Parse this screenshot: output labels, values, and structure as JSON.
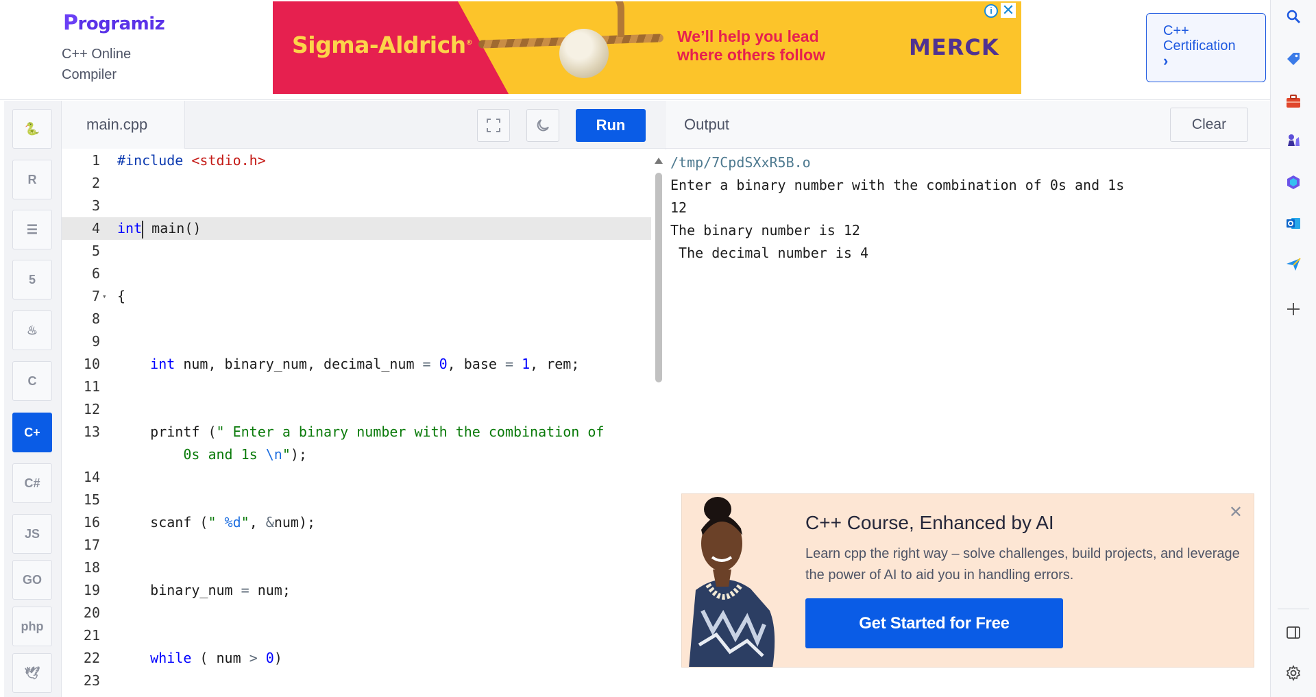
{
  "header": {
    "logo_text": "rogramiz",
    "logo_initial": "P",
    "subtitle": "C++ Online Compiler"
  },
  "ad": {
    "brand": "Sigma-Aldrich",
    "brand_mark": "®",
    "tagline": "We’ll help you lead where others follow",
    "partner": "MERCK",
    "info_glyph": "i",
    "close_glyph": "✕",
    "colors": {
      "red": "#e6204f",
      "yellow": "#fcc42a",
      "purple": "#503291"
    }
  },
  "certification": {
    "label": "C++ Certification",
    "chevron": "›"
  },
  "sidebar": {
    "languages": [
      {
        "name": "python",
        "icon": "python-icon",
        "glyph": "🐍",
        "active": false
      },
      {
        "name": "r",
        "icon": "r-icon",
        "glyph": "R",
        "active": false
      },
      {
        "name": "sql",
        "icon": "database-icon",
        "glyph": "☰",
        "active": false
      },
      {
        "name": "html",
        "icon": "html5-icon",
        "glyph": "5",
        "active": false
      },
      {
        "name": "java",
        "icon": "java-icon",
        "glyph": "♨",
        "active": false
      },
      {
        "name": "c",
        "icon": "c-icon",
        "glyph": "C",
        "active": false
      },
      {
        "name": "cpp",
        "icon": "cpp-icon",
        "glyph": "C+",
        "active": true
      },
      {
        "name": "csharp",
        "icon": "csharp-icon",
        "glyph": "C#",
        "active": false
      },
      {
        "name": "javascript",
        "icon": "js-icon",
        "glyph": "JS",
        "active": false
      },
      {
        "name": "go",
        "icon": "go-icon",
        "glyph": "GO",
        "active": false
      },
      {
        "name": "php",
        "icon": "php-icon",
        "glyph": "php",
        "active": false
      },
      {
        "name": "swift",
        "icon": "swift-icon",
        "glyph": "🕊",
        "active": false
      }
    ]
  },
  "editor": {
    "file_name": "main.cpp",
    "run_label": "Run",
    "active_line": 4,
    "lines": [
      {
        "n": "1",
        "tokens": [
          [
            "pre",
            "#include "
          ],
          [
            "inc",
            "<stdio.h>"
          ]
        ]
      },
      {
        "n": "2",
        "tokens": []
      },
      {
        "n": "3",
        "tokens": []
      },
      {
        "n": "4",
        "tokens": [
          [
            "kw",
            "int"
          ],
          [
            "cursor",
            ""
          ],
          [
            "plain",
            " main()"
          ]
        ]
      },
      {
        "n": "5",
        "tokens": []
      },
      {
        "n": "6",
        "tokens": []
      },
      {
        "n": "7",
        "fold": "▾",
        "tokens": [
          [
            "plain",
            "{"
          ]
        ]
      },
      {
        "n": "8",
        "tokens": []
      },
      {
        "n": "9",
        "tokens": []
      },
      {
        "n": "10",
        "tokens": [
          [
            "plain",
            "    "
          ],
          [
            "kw",
            "int"
          ],
          [
            "plain",
            " num, binary_num, decimal_num "
          ],
          [
            "op",
            "="
          ],
          [
            "plain",
            " "
          ],
          [
            "num",
            "0"
          ],
          [
            "plain",
            ", base "
          ],
          [
            "op",
            "="
          ],
          [
            "plain",
            " "
          ],
          [
            "num",
            "1"
          ],
          [
            "plain",
            ", rem;"
          ]
        ]
      },
      {
        "n": "11",
        "tokens": []
      },
      {
        "n": "12",
        "tokens": []
      },
      {
        "n": "13",
        "tokens": [
          [
            "plain",
            "    printf ("
          ],
          [
            "str",
            "\" Enter a binary number with the combination of"
          ]
        ]
      },
      {
        "n": "",
        "tokens": [
          [
            "str",
            "        0s and 1s "
          ],
          [
            "esc",
            "\\n"
          ],
          [
            "str",
            "\""
          ],
          [
            "plain",
            ");"
          ]
        ]
      },
      {
        "n": "14",
        "tokens": []
      },
      {
        "n": "15",
        "tokens": []
      },
      {
        "n": "16",
        "tokens": [
          [
            "plain",
            "    scanf ("
          ],
          [
            "str",
            "\" "
          ],
          [
            "esc",
            "%d"
          ],
          [
            "str",
            "\""
          ],
          [
            "plain",
            ", "
          ],
          [
            "op",
            "&"
          ],
          [
            "plain",
            "num);"
          ]
        ]
      },
      {
        "n": "17",
        "tokens": []
      },
      {
        "n": "18",
        "tokens": []
      },
      {
        "n": "19",
        "tokens": [
          [
            "plain",
            "    binary_num "
          ],
          [
            "op",
            "="
          ],
          [
            "plain",
            " num;"
          ]
        ]
      },
      {
        "n": "20",
        "tokens": []
      },
      {
        "n": "21",
        "tokens": []
      },
      {
        "n": "22",
        "tokens": [
          [
            "plain",
            "    "
          ],
          [
            "kw",
            "while"
          ],
          [
            "plain",
            " ( num "
          ],
          [
            "op",
            ">"
          ],
          [
            "plain",
            " "
          ],
          [
            "num",
            "0"
          ],
          [
            "plain",
            ")"
          ]
        ]
      },
      {
        "n": "23",
        "tokens": []
      }
    ]
  },
  "output": {
    "title": "Output",
    "clear_label": "Clear",
    "lines": [
      "/tmp/7CpdSXxR5B.o",
      "Enter a binary number with the combination of 0s and 1s",
      "12",
      "The binary number is 12",
      " The decimal number is 4"
    ]
  },
  "promo": {
    "title": "C++ Course, Enhanced by AI",
    "description": "Learn cpp the right way – solve challenges, build projects, and leverage the power of AI to aid you in handling errors.",
    "cta": "Get Started for Free",
    "close_glyph": "✕"
  },
  "browser_rail": {
    "icons": [
      "search-icon",
      "tag-icon",
      "briefcase-icon",
      "chess-icon",
      "copilot-icon",
      "outlook-icon",
      "send-icon",
      "add-icon",
      "sidebar-toggle-icon",
      "settings-icon"
    ]
  },
  "colors": {
    "brand_blue": "#0a5ce6",
    "programiz_purple": "#5a32e8"
  }
}
